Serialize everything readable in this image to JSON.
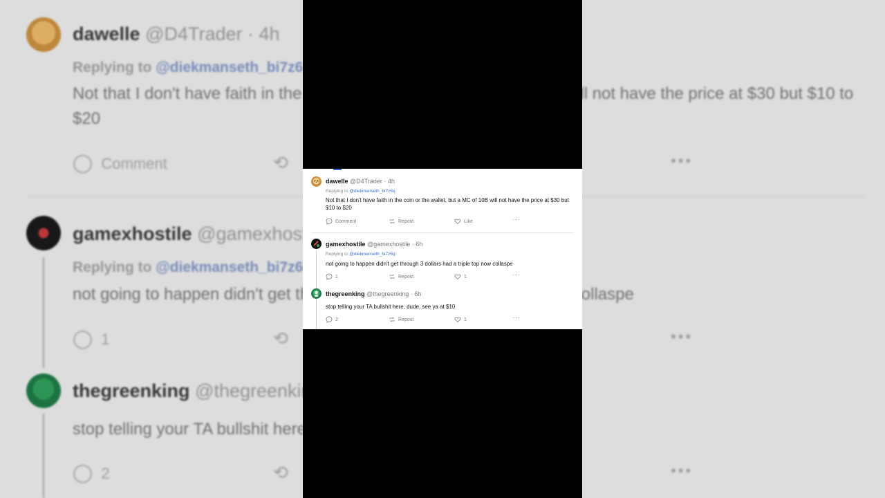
{
  "comments": [
    {
      "name": "dawelle",
      "handle": "@D4Trader",
      "time": "· 4h",
      "reply_prefix": "Replying to",
      "reply_to": "@diekmanseth_bi7z6q",
      "text": "Not that I don't have faith in the coin or the wallet, but a MC of 10B will not have the price at $30 but $10 to $20",
      "comment_label": "Comment",
      "repost_label": "Repost",
      "like_label": "Like"
    },
    {
      "name": "gamexhostile",
      "handle": "@gamexhostile",
      "time": "· 6h",
      "reply_prefix": "Replying to",
      "reply_to": "@diekmanseth_bi7z6q",
      "text": "not going to happen didn't get through 3 dollars had a triple top now collaspe",
      "comment_count": "1",
      "repost_label": "Repost",
      "like_count": "1"
    },
    {
      "name": "thegreenking",
      "handle": "@thegreenking",
      "time": "· 6h",
      "text": "stop telling your TA bullshit here, dude, see ya at $10",
      "comment_count": "2",
      "repost_label": "Repost",
      "like_count": "1"
    }
  ],
  "icons": {
    "comment": "comment-bubble-icon",
    "repost": "repost-icon",
    "like": "heart-icon",
    "more": "more-options-icon"
  },
  "colors": {
    "mention": "#3b6fd6",
    "background": "#000000",
    "card": "#ffffff"
  }
}
